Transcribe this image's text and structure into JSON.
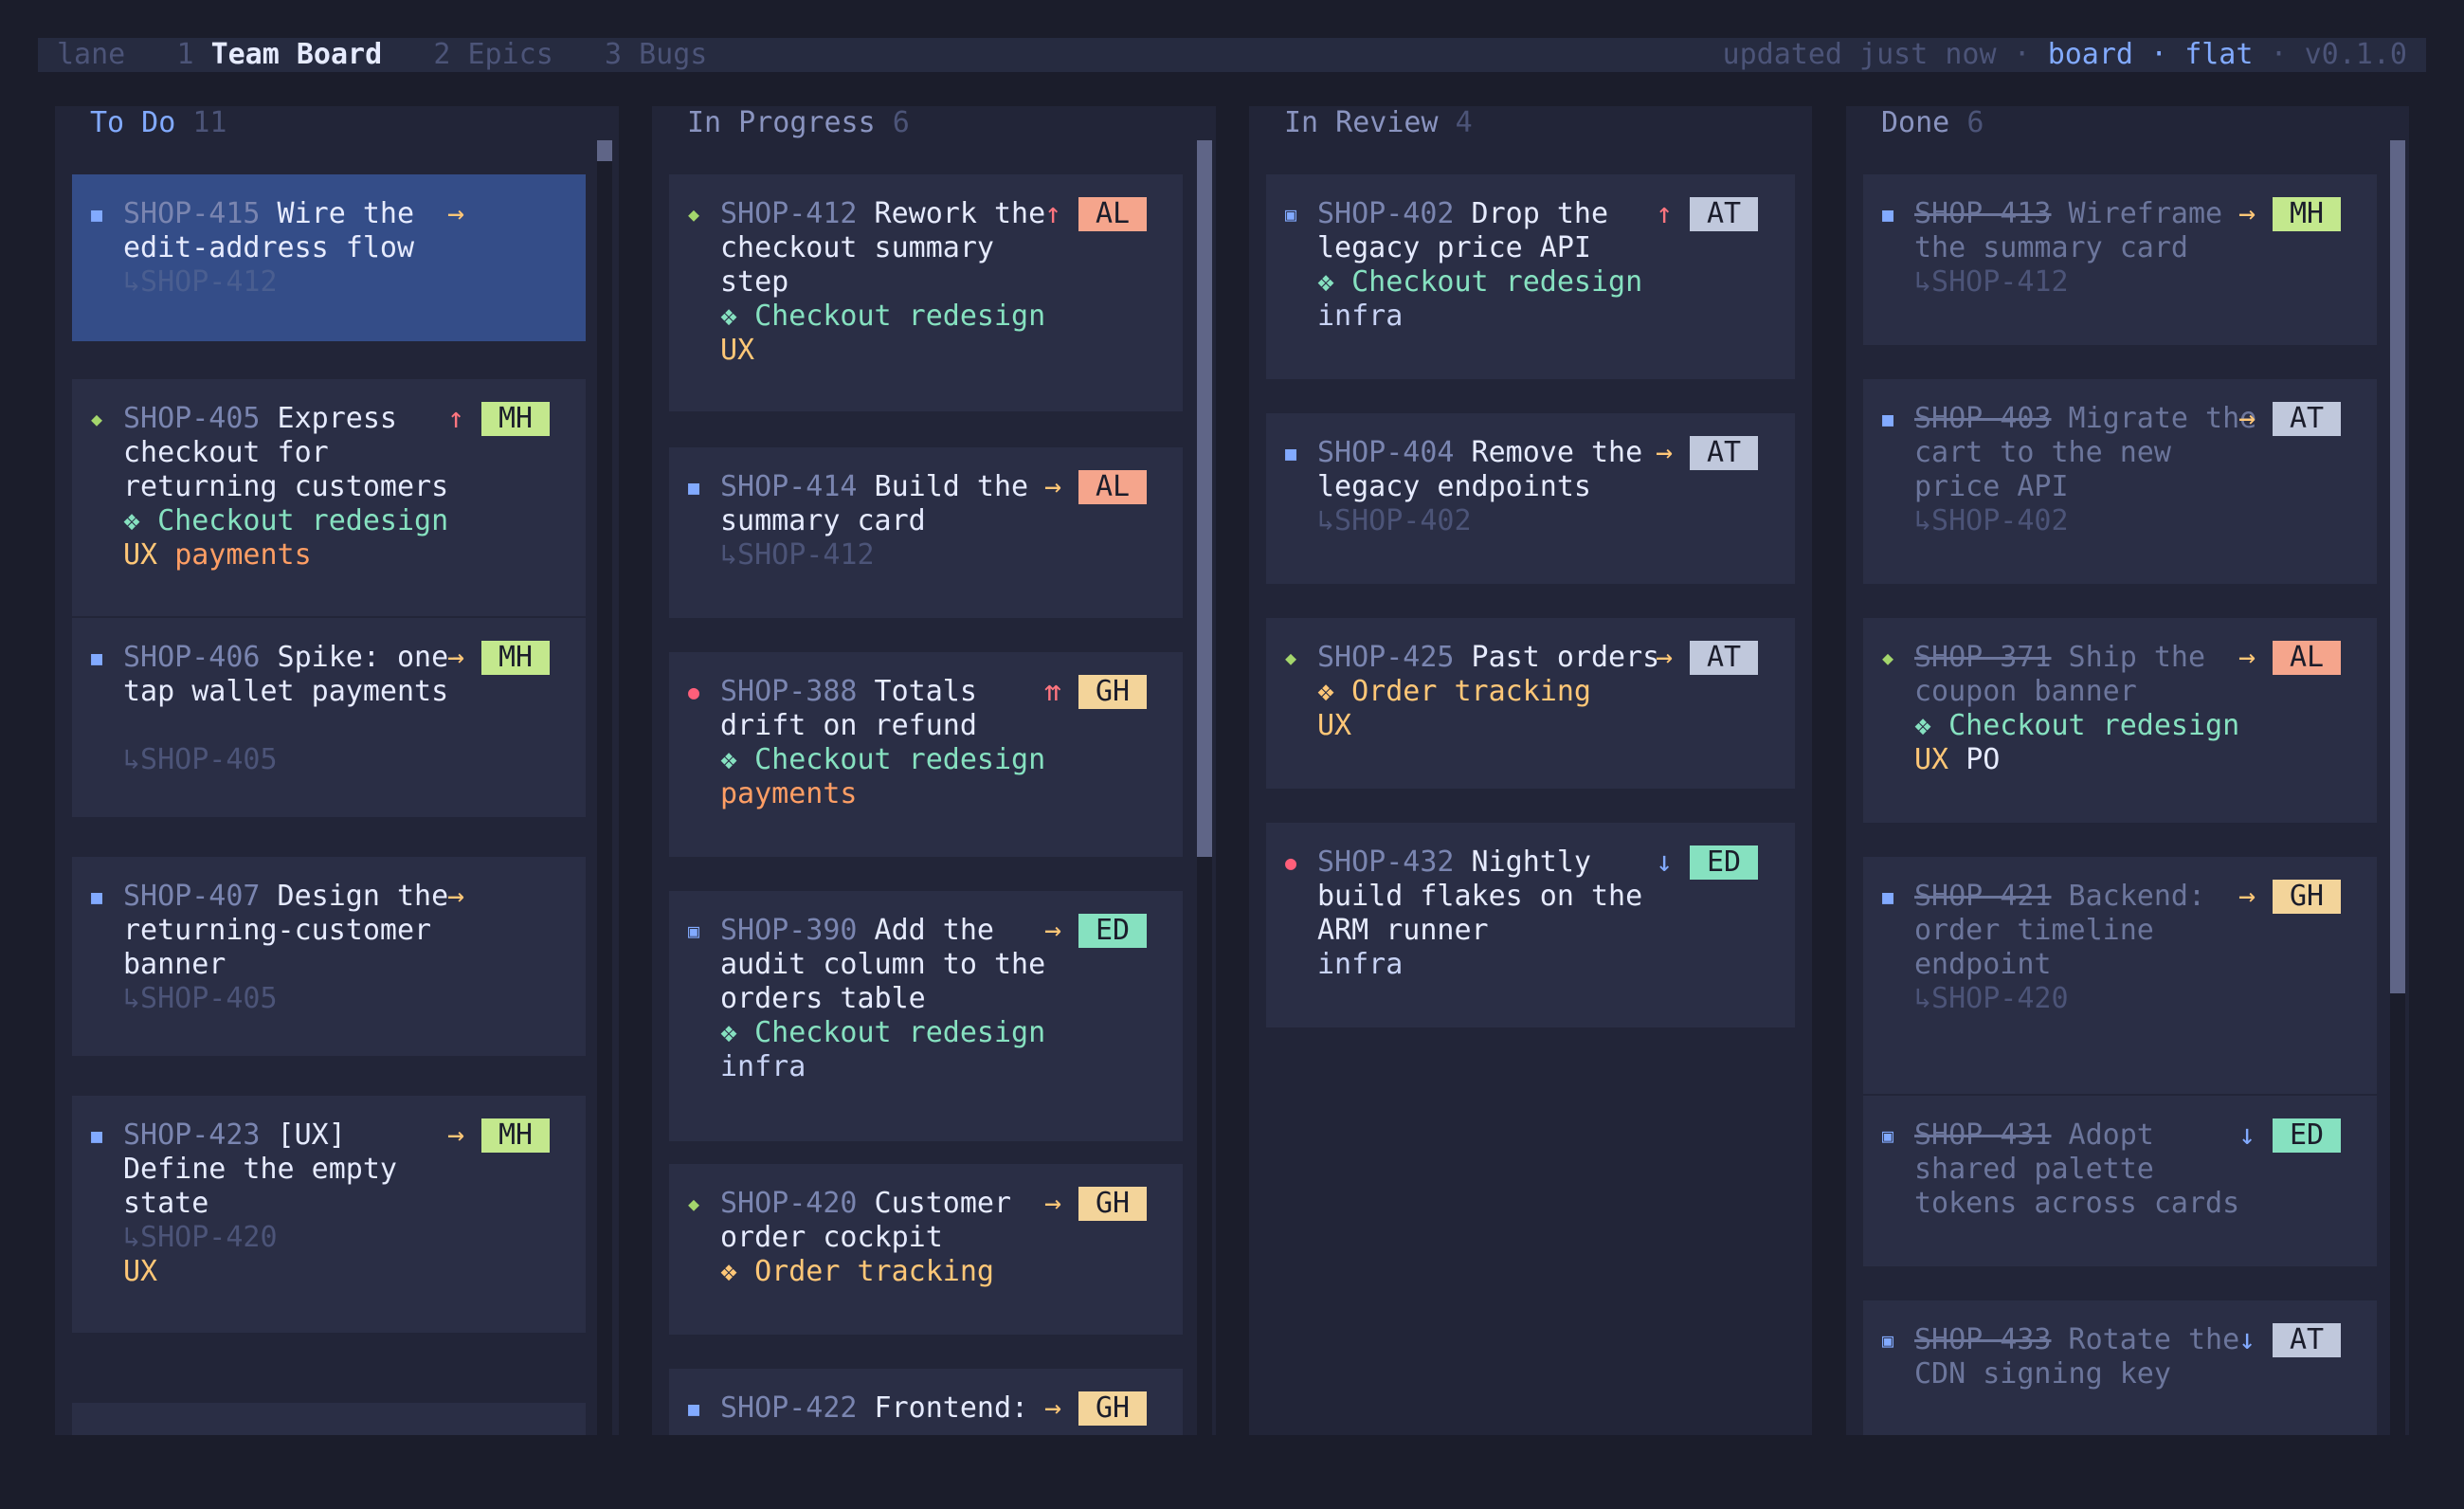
{
  "topbar": {
    "lane_label": "lane",
    "tabs": [
      {
        "num": "1",
        "label": "Team Board",
        "active": true
      },
      {
        "num": "2",
        "label": "Epics"
      },
      {
        "num": "3",
        "label": "Bugs"
      }
    ],
    "status": "updated just now",
    "sep": "·",
    "view": "board",
    "mode": "flat",
    "version": "v0.1.0"
  },
  "columns": [
    {
      "title": "To Do",
      "count": "11",
      "cards": [
        {
          "type_icon": "■",
          "id": "SHOP-415",
          "priority": "→",
          "lines": [
            {
              "parts": [
                {
                  "t": "id",
                  "v": "SHOP-415"
                },
                {
                  "t": "ttl",
                  "v": " Wire the"
                }
              ]
            },
            {
              "parts": [
                {
                  "t": "ttl",
                  "v": "edit-address flow"
                }
              ]
            },
            {
              "parts": [
                {
                  "t": "ref",
                  "v": "↳SHOP-412"
                }
              ]
            }
          ]
        },
        {
          "type_icon": "◆",
          "id": "SHOP-405",
          "priority": "↑",
          "assignee": "MH",
          "lines": [
            {
              "parts": [
                {
                  "t": "id",
                  "v": "SHOP-405"
                },
                {
                  "t": "ttl",
                  "v": " Express"
                }
              ]
            },
            {
              "parts": [
                {
                  "t": "ttl",
                  "v": "checkout for"
                }
              ]
            },
            {
              "parts": [
                {
                  "t": "ttl",
                  "v": "returning customers"
                }
              ]
            },
            {
              "parts": [
                {
                  "t": "epic",
                  "v": "❖ Checkout redesign"
                }
              ]
            },
            {
              "parts": [
                {
                  "t": "ux",
                  "v": "UX"
                },
                {
                  "t": "ttl",
                  "v": " "
                },
                {
                  "t": "payments",
                  "v": "payments"
                }
              ]
            }
          ]
        },
        {
          "type_icon": "■",
          "id": "SHOP-406",
          "priority": "→",
          "assignee": "MH",
          "lines": [
            {
              "parts": [
                {
                  "t": "id",
                  "v": "SHOP-406"
                },
                {
                  "t": "ttl",
                  "v": " Spike: one-"
                }
              ]
            },
            {
              "parts": [
                {
                  "t": "ttl",
                  "v": "tap wallet payments"
                }
              ]
            },
            {
              "parts": []
            },
            {
              "parts": [
                {
                  "t": "ref",
                  "v": "↳SHOP-405"
                }
              ]
            }
          ]
        },
        {
          "type_icon": "■",
          "id": "SHOP-407",
          "priority": "→",
          "lines": [
            {
              "parts": [
                {
                  "t": "id",
                  "v": "SHOP-407"
                },
                {
                  "t": "ttl",
                  "v": " Design the"
                }
              ]
            },
            {
              "parts": [
                {
                  "t": "ttl",
                  "v": "returning-customer"
                }
              ]
            },
            {
              "parts": [
                {
                  "t": "ttl",
                  "v": "banner"
                }
              ]
            },
            {
              "parts": [
                {
                  "t": "ref",
                  "v": "↳SHOP-405"
                }
              ]
            }
          ]
        },
        {
          "type_icon": "■",
          "id": "SHOP-423",
          "priority": "→",
          "assignee": "MH",
          "lines": [
            {
              "parts": [
                {
                  "t": "id",
                  "v": "SHOP-423"
                },
                {
                  "t": "ttl",
                  "v": " [UX]"
                }
              ]
            },
            {
              "parts": [
                {
                  "t": "ttl",
                  "v": "Define the empty"
                }
              ]
            },
            {
              "parts": [
                {
                  "t": "ttl",
                  "v": "state"
                }
              ]
            },
            {
              "parts": [
                {
                  "t": "ref",
                  "v": "↳SHOP-420"
                }
              ]
            },
            {
              "parts": [
                {
                  "t": "ux",
                  "v": "UX"
                }
              ]
            }
          ]
        },
        {
          "lines": []
        }
      ]
    },
    {
      "title": "In Progress",
      "count": "6",
      "cards": [
        {
          "type_icon": "◆",
          "id": "SHOP-412",
          "priority": "↑",
          "assignee": "AL",
          "lines": [
            {
              "parts": [
                {
                  "t": "id",
                  "v": "SHOP-412"
                },
                {
                  "t": "ttl",
                  "v": " Rework the"
                }
              ]
            },
            {
              "parts": [
                {
                  "t": "ttl",
                  "v": "checkout summary"
                }
              ]
            },
            {
              "parts": [
                {
                  "t": "ttl",
                  "v": "step"
                }
              ]
            },
            {
              "parts": [
                {
                  "t": "epic",
                  "v": "❖ Checkout redesign"
                }
              ]
            },
            {
              "parts": [
                {
                  "t": "ux",
                  "v": "UX"
                }
              ]
            }
          ]
        },
        {
          "type_icon": "■",
          "id": "SHOP-414",
          "priority": "→",
          "assignee": "AL",
          "lines": [
            {
              "parts": [
                {
                  "t": "id",
                  "v": "SHOP-414"
                },
                {
                  "t": "ttl",
                  "v": " Build the"
                }
              ]
            },
            {
              "parts": [
                {
                  "t": "ttl",
                  "v": "summary card"
                }
              ]
            },
            {
              "parts": [
                {
                  "t": "ref",
                  "v": "↳SHOP-412"
                }
              ]
            }
          ]
        },
        {
          "type_icon": "●",
          "id": "SHOP-388",
          "priority": "⇈",
          "assignee": "GH",
          "lines": [
            {
              "parts": [
                {
                  "t": "id",
                  "v": "SHOP-388"
                },
                {
                  "t": "ttl",
                  "v": " Totals"
                }
              ]
            },
            {
              "parts": [
                {
                  "t": "ttl",
                  "v": "drift on refund"
                }
              ]
            },
            {
              "parts": [
                {
                  "t": "epic",
                  "v": "❖ Checkout redesign"
                }
              ]
            },
            {
              "parts": [
                {
                  "t": "payments",
                  "v": "payments"
                }
              ]
            }
          ]
        },
        {
          "type_icon": "▣",
          "id": "SHOP-390",
          "priority": "→",
          "assignee": "ED",
          "lines": [
            {
              "parts": [
                {
                  "t": "id",
                  "v": "SHOP-390"
                },
                {
                  "t": "ttl",
                  "v": " Add the"
                }
              ]
            },
            {
              "parts": [
                {
                  "t": "ttl",
                  "v": "audit column to the"
                }
              ]
            },
            {
              "parts": [
                {
                  "t": "ttl",
                  "v": "orders table"
                }
              ]
            },
            {
              "parts": [
                {
                  "t": "epic",
                  "v": "❖ Checkout redesign"
                }
              ]
            },
            {
              "parts": [
                {
                  "t": "infra",
                  "v": "infra"
                }
              ]
            }
          ]
        },
        {
          "type_icon": "◆",
          "id": "SHOP-420",
          "priority": "→",
          "assignee": "GH",
          "lines": [
            {
              "parts": [
                {
                  "t": "id",
                  "v": "SHOP-420"
                },
                {
                  "t": "ttl",
                  "v": " Customer"
                }
              ]
            },
            {
              "parts": [
                {
                  "t": "ttl",
                  "v": "order cockpit"
                }
              ]
            },
            {
              "parts": [
                {
                  "t": "ux",
                  "v": "❖ Order tracking"
                }
              ]
            }
          ]
        },
        {
          "type_icon": "■",
          "id": "SHOP-422",
          "priority": "→",
          "assignee": "GH",
          "lines": [
            {
              "parts": [
                {
                  "t": "id",
                  "v": "SHOP-422"
                },
                {
                  "t": "ttl",
                  "v": " Frontend:"
                }
              ]
            }
          ]
        }
      ]
    },
    {
      "title": "In Review",
      "count": "4",
      "cards": [
        {
          "type_icon": "▣",
          "id": "SHOP-402",
          "priority": "↑",
          "assignee": "AT",
          "lines": [
            {
              "parts": [
                {
                  "t": "id",
                  "v": "SHOP-402"
                },
                {
                  "t": "ttl",
                  "v": " Drop the"
                }
              ]
            },
            {
              "parts": [
                {
                  "t": "ttl",
                  "v": "legacy price API"
                }
              ]
            },
            {
              "parts": [
                {
                  "t": "epic",
                  "v": "❖ Checkout redesign"
                }
              ]
            },
            {
              "parts": [
                {
                  "t": "infra",
                  "v": "infra"
                }
              ]
            }
          ]
        },
        {
          "type_icon": "■",
          "id": "SHOP-404",
          "priority": "→",
          "assignee": "AT",
          "lines": [
            {
              "parts": [
                {
                  "t": "id",
                  "v": "SHOP-404"
                },
                {
                  "t": "ttl",
                  "v": " Remove the"
                }
              ]
            },
            {
              "parts": [
                {
                  "t": "ttl",
                  "v": "legacy endpoints"
                }
              ]
            },
            {
              "parts": [
                {
                  "t": "ref",
                  "v": "↳SHOP-402"
                }
              ]
            }
          ]
        },
        {
          "type_icon": "◆",
          "id": "SHOP-425",
          "priority": "→",
          "assignee": "AT",
          "lines": [
            {
              "parts": [
                {
                  "t": "id",
                  "v": "SHOP-425"
                },
                {
                  "t": "ttl",
                  "v": " Past orders"
                }
              ]
            },
            {
              "parts": [
                {
                  "t": "ux",
                  "v": "❖ Order tracking"
                }
              ]
            },
            {
              "parts": [
                {
                  "t": "ux",
                  "v": "UX"
                }
              ]
            }
          ]
        },
        {
          "type_icon": "●",
          "id": "SHOP-432",
          "priority": "↓",
          "assignee": "ED",
          "lines": [
            {
              "parts": [
                {
                  "t": "id",
                  "v": "SHOP-432"
                },
                {
                  "t": "ttl",
                  "v": " Nightly"
                }
              ]
            },
            {
              "parts": [
                {
                  "t": "ttl",
                  "v": "build flakes on the"
                }
              ]
            },
            {
              "parts": [
                {
                  "t": "ttl",
                  "v": "ARM runner"
                }
              ]
            },
            {
              "parts": [
                {
                  "t": "infra",
                  "v": "infra"
                }
              ]
            }
          ]
        }
      ]
    },
    {
      "title": "Done",
      "count": "6",
      "cards": [
        {
          "type_icon": "■",
          "id": "SHOP-413",
          "priority": "→",
          "assignee": "MH",
          "lines": [
            {
              "parts": [
                {
                  "t": "id",
                  "v": "SHOP-413"
                },
                {
                  "t": "ttl",
                  "v": " Wireframe"
                }
              ]
            },
            {
              "parts": [
                {
                  "t": "ttl",
                  "v": "the summary card"
                }
              ]
            },
            {
              "parts": [
                {
                  "t": "ref",
                  "v": "↳SHOP-412"
                }
              ]
            }
          ]
        },
        {
          "type_icon": "■",
          "id": "SHOP-403",
          "priority": "→",
          "assignee": "AT",
          "lines": [
            {
              "parts": [
                {
                  "t": "id",
                  "v": "SHOP-403"
                },
                {
                  "t": "ttl",
                  "v": " Migrate the"
                }
              ]
            },
            {
              "parts": [
                {
                  "t": "ttl",
                  "v": "cart to the new"
                }
              ]
            },
            {
              "parts": [
                {
                  "t": "ttl",
                  "v": "price API"
                }
              ]
            },
            {
              "parts": [
                {
                  "t": "ref",
                  "v": "↳SHOP-402"
                }
              ]
            }
          ]
        },
        {
          "type_icon": "◆",
          "id": "SHOP-371",
          "priority": "→",
          "assignee": "AL",
          "lines": [
            {
              "parts": [
                {
                  "t": "id",
                  "v": "SHOP-371"
                },
                {
                  "t": "ttl",
                  "v": " Ship the"
                }
              ]
            },
            {
              "parts": [
                {
                  "t": "ttl",
                  "v": "coupon banner"
                }
              ]
            },
            {
              "parts": [
                {
                  "t": "epic",
                  "v": "❖ Checkout redesign"
                }
              ]
            },
            {
              "parts": [
                {
                  "t": "ux",
                  "v": "UX"
                },
                {
                  "t": "ttl",
                  "v": " "
                },
                {
                  "t": "po",
                  "v": "PO"
                }
              ]
            }
          ]
        },
        {
          "type_icon": "■",
          "id": "SHOP-421",
          "priority": "→",
          "assignee": "GH",
          "lines": [
            {
              "parts": [
                {
                  "t": "id",
                  "v": "SHOP-421"
                },
                {
                  "t": "ttl",
                  "v": " Backend:"
                }
              ]
            },
            {
              "parts": [
                {
                  "t": "ttl",
                  "v": "order timeline"
                }
              ]
            },
            {
              "parts": [
                {
                  "t": "ttl",
                  "v": "endpoint"
                }
              ]
            },
            {
              "parts": [
                {
                  "t": "ref",
                  "v": "↳SHOP-420"
                }
              ]
            }
          ]
        },
        {
          "type_icon": "▣",
          "id": "SHOP-431",
          "priority": "↓",
          "assignee": "ED",
          "lines": [
            {
              "parts": [
                {
                  "t": "id",
                  "v": "SHOP-431"
                },
                {
                  "t": "ttl",
                  "v": " Adopt"
                }
              ]
            },
            {
              "parts": [
                {
                  "t": "ttl",
                  "v": "shared palette"
                }
              ]
            },
            {
              "parts": [
                {
                  "t": "ttl",
                  "v": "tokens across cards"
                }
              ]
            }
          ]
        },
        {
          "type_icon": "▣",
          "id": "SHOP-433",
          "priority": "↓",
          "assignee": "AT",
          "lines": [
            {
              "parts": [
                {
                  "t": "id",
                  "v": "SHOP-433"
                },
                {
                  "t": "ttl",
                  "v": " Rotate the"
                }
              ]
            },
            {
              "parts": [
                {
                  "t": "ttl",
                  "v": "CDN signing key"
                }
              ]
            }
          ]
        }
      ]
    }
  ]
}
